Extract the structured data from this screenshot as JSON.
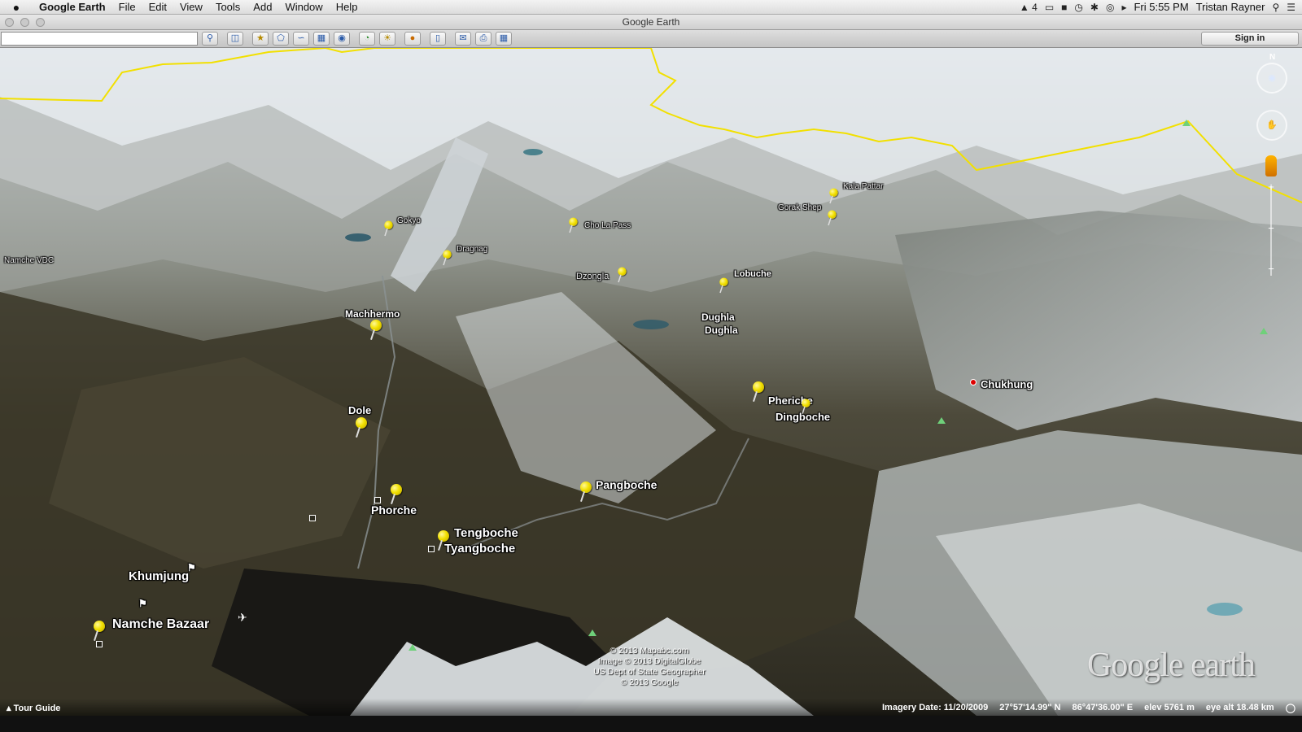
{
  "menubar": {
    "apple": "",
    "items": [
      "Google Earth",
      "File",
      "Edit",
      "View",
      "Tools",
      "Add",
      "Window",
      "Help"
    ],
    "status_icons": [
      "adobe-icon",
      "airplay-icon",
      "lock-icon",
      "time-machine-icon",
      "bluetooth-icon",
      "wifi-icon",
      "volume-icon"
    ],
    "adobe_count": "4",
    "clock": "Fri 5:55 PM",
    "user": "Tristan Rayner"
  },
  "window": {
    "title": "Google Earth"
  },
  "toolbar": {
    "search_placeholder": "",
    "signin": "Sign in"
  },
  "places": [
    {
      "name": "Gokyo",
      "size": "l10"
    },
    {
      "name": "Dragnag",
      "size": "l10"
    },
    {
      "name": "Cho La Pass",
      "size": "l10"
    },
    {
      "name": "Kala Pattar",
      "size": "l10"
    },
    {
      "name": "Gorak Shep",
      "size": "l10"
    },
    {
      "name": "Dzongla",
      "size": "l11"
    },
    {
      "name": "Lobuche",
      "size": "l11"
    },
    {
      "name": "Namche VDC",
      "size": "l10"
    },
    {
      "name": "Machhermo",
      "size": "l12"
    },
    {
      "name": "Dughla",
      "size": "l12"
    },
    {
      "name": "Dughla",
      "size": "l12"
    },
    {
      "name": "Chukhung",
      "size": "l13"
    },
    {
      "name": "Pheriche",
      "size": "l13"
    },
    {
      "name": "Dingboche",
      "size": "l13"
    },
    {
      "name": "Dole",
      "size": "l13"
    },
    {
      "name": "Pangboche",
      "size": "l14"
    },
    {
      "name": "Phorche",
      "size": "l14"
    },
    {
      "name": "Tengboche",
      "size": "l15"
    },
    {
      "name": "Tyangboche",
      "size": "l15"
    },
    {
      "name": "Khumjung",
      "size": "l15"
    },
    {
      "name": "Namche Bazaar",
      "size": "l16"
    }
  ],
  "copyright": [
    "© 2013 Mapabc.com",
    "Image © 2013 DigitalGlobe",
    "US Dept of State Geographer",
    "© 2013 Google"
  ],
  "logo": "Google earth",
  "statusbar": {
    "tour_guide": "Tour Guide",
    "imagery_date": "Imagery Date: 11/20/2009",
    "lat": "27°57'14.99\" N",
    "lon": "86°47'36.00\" E",
    "elev": "elev  5761 m",
    "eye_alt": "eye alt  18.48 km"
  },
  "nav": {
    "north": "N"
  },
  "colors": {
    "border_line": "#f2e000",
    "pin": "#f2e000",
    "snow": "#e8eef2",
    "valley": "#3d3a2c"
  }
}
